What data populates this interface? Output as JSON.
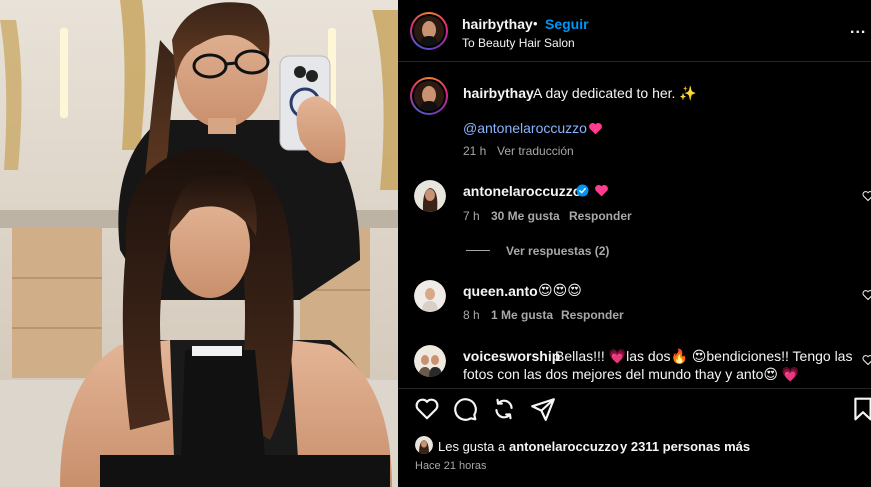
{
  "post": {
    "author": "hairbythay",
    "separator": "•",
    "follow_label": "Seguir",
    "location": "To Beauty Hair Salon",
    "more_label": "...",
    "caption_user": "hairbythay",
    "caption_text": "A day dedicated to her. ✨",
    "caption_mention": "@antonelaroccuzzo",
    "caption_time": "21 h",
    "translate_label": "Ver traducción"
  },
  "comments": [
    {
      "user": "antonelaroccuzzo",
      "verified": true,
      "text": "",
      "time": "7 h",
      "likes": "30 Me gusta",
      "reply_label": "Responder",
      "view_replies": "Ver respuestas (2)"
    },
    {
      "user": "queen.anto",
      "text": "😍😍😍",
      "time": "8 h",
      "likes": "1 Me gusta",
      "reply_label": "Responder"
    },
    {
      "user": "voicesworship",
      "text_line1": "Bellas!!! 💗las dos🔥 😍bendiciones!! Tengo las",
      "text_line2": "fotos con las dos mejores del mundo thay y anto😍 💗"
    }
  ],
  "likes": {
    "prefix": "Les gusta a",
    "user": "antonelaroccuzzo",
    "suffix": "y 2311 personas más",
    "time": "Hace 21 horas"
  },
  "icons": {
    "like": "heart-icon",
    "comment": "comment-icon",
    "share": "repost-icon",
    "send": "send-icon",
    "save": "bookmark-icon"
  },
  "colors": {
    "background": "#000000",
    "follow": "#0095f6",
    "heart": "#ff3040",
    "verified": "#0095f6",
    "muted": "#a8a8a8"
  }
}
